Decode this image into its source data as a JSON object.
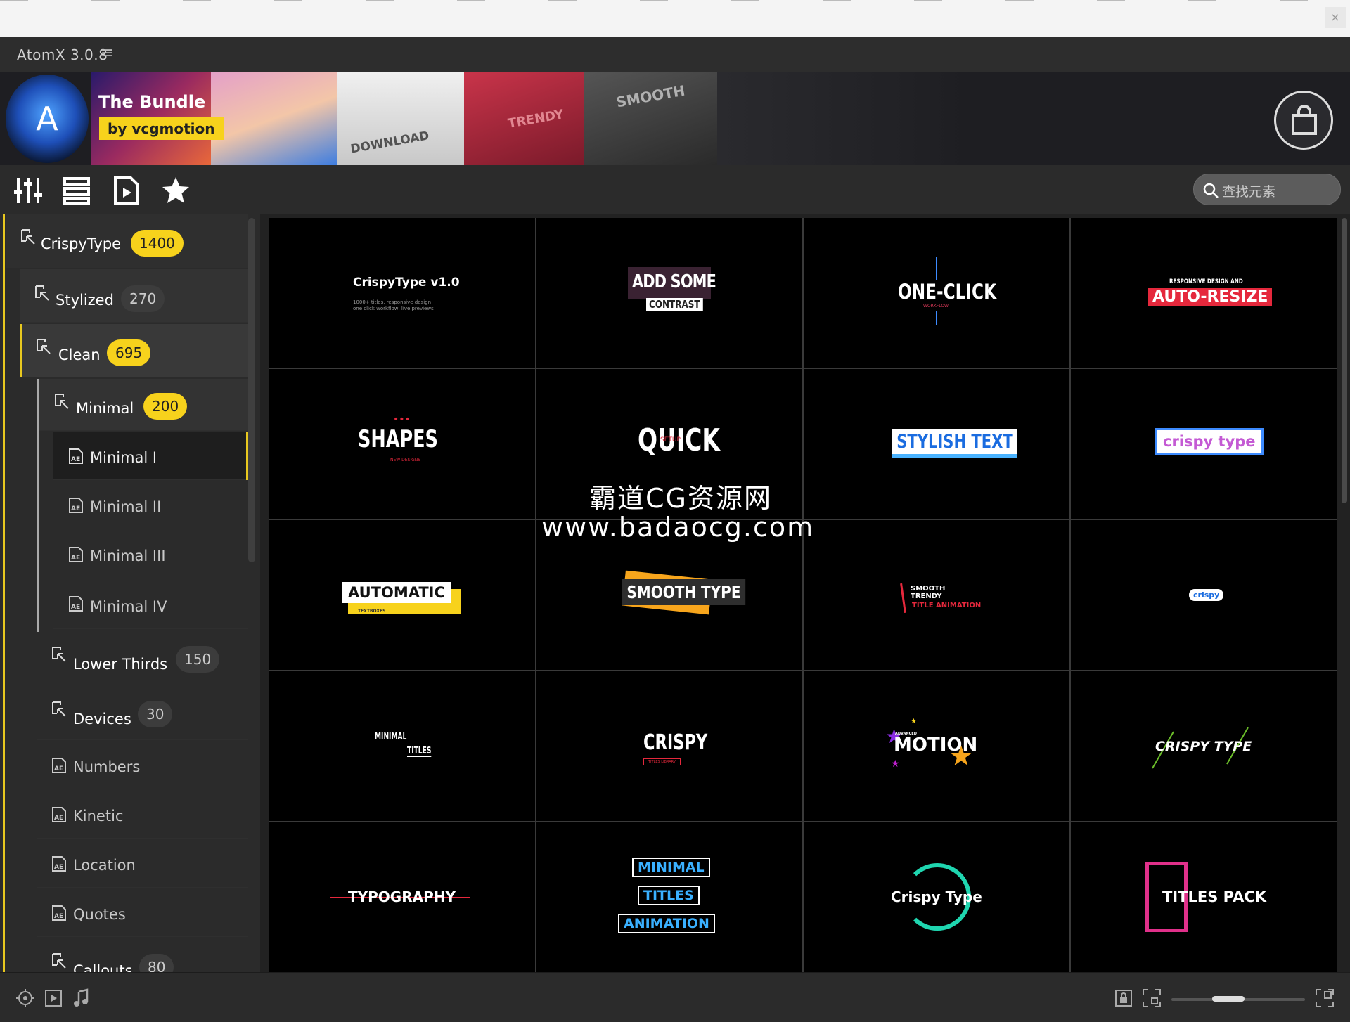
{
  "window": {
    "title": "AtomX 3.0.8",
    "close_label": "×"
  },
  "banner": {
    "name": "The Bundle",
    "by": "by vcgmotion",
    "logo_letter": "A",
    "tiles": [
      {
        "color": "#0e5dd1"
      },
      {
        "color": "#e4a0c8"
      },
      {
        "color": "#f2f2f2"
      },
      {
        "color": "#c9344a"
      },
      {
        "color": "#454545"
      },
      {
        "color": "#1e1e22"
      }
    ],
    "tile_texts": [
      "DOWNLOAD",
      "TRENDY",
      "SMOOTH"
    ]
  },
  "toolbar": {
    "icons": [
      "sliders-icon",
      "list-icon",
      "video-file-icon",
      "star-icon"
    ]
  },
  "search": {
    "placeholder": "查找元素"
  },
  "sidebar": {
    "items": [
      {
        "label": "CrispyType",
        "count": "1400",
        "badge": "yellow",
        "type": "folder"
      },
      {
        "label": "Stylized",
        "count": "270",
        "badge": "gray",
        "type": "folder"
      },
      {
        "label": "Clean",
        "count": "695",
        "badge": "yellow",
        "type": "folder"
      },
      {
        "label": "Minimal",
        "count": "200",
        "badge": "yellow",
        "type": "folder"
      },
      {
        "label": "Minimal I",
        "type": "ae"
      },
      {
        "label": "Minimal II",
        "type": "ae"
      },
      {
        "label": "Minimal III",
        "type": "ae"
      },
      {
        "label": "Minimal IV",
        "type": "ae"
      },
      {
        "label": "Lower Thirds",
        "count": "150",
        "badge": "gray",
        "type": "folder"
      },
      {
        "label": "Devices",
        "count": "30",
        "badge": "gray",
        "type": "folder"
      },
      {
        "label": "Numbers",
        "type": "ae"
      },
      {
        "label": "Kinetic",
        "type": "ae"
      },
      {
        "label": "Location",
        "type": "ae"
      },
      {
        "label": "Quotes",
        "type": "ae"
      },
      {
        "label": "Callouts",
        "count": "80",
        "badge": "gray",
        "type": "folder"
      }
    ]
  },
  "grid": {
    "cells": [
      {
        "main": "CrispyType v1.0",
        "sub": "1000+ titles, responsive design one click workflow, live previews"
      },
      {
        "main": "ADD SOME",
        "sub": "CONTRAST"
      },
      {
        "main": "ONE-CLICK",
        "sub": "WORKFLOW"
      },
      {
        "main": "AUTO-RESIZE",
        "sub": "RESPONSIVE DESIGN AND"
      },
      {
        "main": "SHAPES",
        "sub": "NEW DESIGNS"
      },
      {
        "main": "QUICK",
        "sub": "SETUP"
      },
      {
        "main": "STYLISH TEXT",
        "sub": ""
      },
      {
        "main": "crispy type",
        "sub": ""
      },
      {
        "main": "AUTOMATIC",
        "sub": "TEXTBOXES"
      },
      {
        "main": "SMOOTH TYPE",
        "sub": ""
      },
      {
        "main": "SMOOTH TRENDY",
        "sub": "TITLE ANIMATION"
      },
      {
        "main": "crispy",
        "sub": ""
      },
      {
        "main": "MINIMAL",
        "sub": "TITLES"
      },
      {
        "main": "CRISPY",
        "sub": "TITLES LIBRARY"
      },
      {
        "main": "MOTION",
        "sub": "ADVANCED"
      },
      {
        "main": "CRISPY TYPE",
        "sub": ""
      },
      {
        "main": "TYPOGRAPHY",
        "sub": ""
      },
      {
        "main": "MINIMAL",
        "sub": "TITLES",
        "sub2": "ANIMATION"
      },
      {
        "main": "Crispy Type",
        "sub": ""
      },
      {
        "main": "TITLES PACK",
        "sub": ""
      }
    ]
  },
  "watermark": {
    "line1": "霸道CG资源网",
    "line2": "www.badaocg.com"
  },
  "status": {
    "left_icons": [
      "target-icon",
      "play-icon",
      "music-icon"
    ],
    "right_icons": [
      "lock-icon",
      "fit-icon",
      "expand-icon"
    ]
  },
  "colors": {
    "accent": "#f7d21c",
    "panel": "#2b2b2b",
    "grid_bg": "#000000"
  }
}
